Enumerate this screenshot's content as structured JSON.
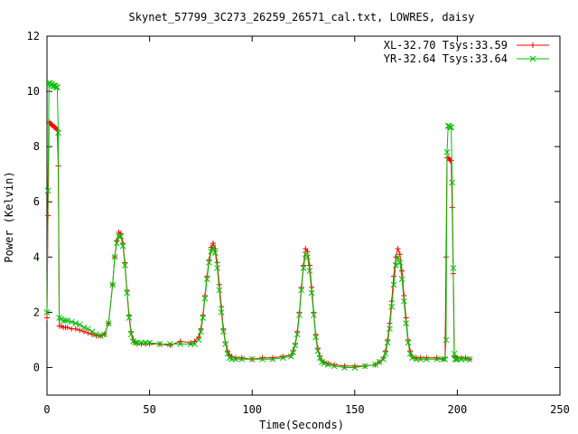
{
  "chart_data": {
    "type": "line",
    "title": "Skynet_57799_3C273_26259_26571_cal.txt, LOWRES, daisy",
    "xlabel": "Time(Seconds)",
    "ylabel": "Power (Kelvin)",
    "xlim": [
      0,
      250
    ],
    "ylim": [
      -1,
      12
    ],
    "xticks": [
      0,
      50,
      100,
      150,
      200,
      250
    ],
    "yticks": [
      0,
      2,
      4,
      6,
      8,
      10,
      12
    ],
    "grid": false,
    "legend_position": "top-right",
    "series": [
      {
        "name": "XL-32.70 Tsys:33.59",
        "color": "#ff0000",
        "marker": "+",
        "x": [
          0,
          0.5,
          1,
          1.5,
          2,
          2.5,
          3,
          3.5,
          4,
          4.5,
          5,
          5.5,
          6,
          7,
          8,
          9,
          10,
          12,
          14,
          16,
          18,
          20,
          22,
          24,
          26,
          28,
          30,
          32,
          33,
          34,
          35,
          36,
          37,
          38,
          39,
          40,
          41,
          42,
          43,
          44,
          46,
          48,
          50,
          55,
          60,
          65,
          70,
          72,
          74,
          75,
          76,
          77,
          78,
          79,
          80,
          81,
          82,
          83,
          84,
          85,
          86,
          87,
          88,
          89,
          90,
          92,
          95,
          100,
          105,
          110,
          115,
          119,
          120,
          121,
          122,
          123,
          124,
          125,
          126,
          127,
          128,
          129,
          130,
          131,
          132,
          133,
          134,
          135,
          137,
          140,
          145,
          150,
          155,
          160,
          162,
          164,
          165,
          166,
          167,
          168,
          169,
          170,
          171,
          172,
          173,
          174,
          175,
          176,
          177,
          178,
          180,
          182,
          185,
          190,
          193,
          194,
          194.5,
          195,
          195.5,
          196,
          196.5,
          197,
          197.5,
          198,
          198.5,
          199,
          199.5,
          200,
          202,
          204,
          206
        ],
        "y": [
          1.8,
          5.5,
          8.9,
          8.85,
          8.8,
          8.8,
          8.75,
          8.7,
          8.7,
          8.65,
          8.6,
          7.3,
          1.5,
          1.5,
          1.45,
          1.45,
          1.45,
          1.4,
          1.4,
          1.35,
          1.3,
          1.25,
          1.2,
          1.15,
          1.15,
          1.2,
          1.6,
          3.0,
          4.0,
          4.6,
          4.9,
          4.85,
          4.5,
          3.8,
          2.8,
          1.9,
          1.3,
          1.0,
          0.9,
          0.85,
          0.85,
          0.85,
          0.85,
          0.85,
          0.8,
          0.95,
          0.9,
          0.95,
          1.1,
          1.4,
          1.9,
          2.6,
          3.3,
          3.9,
          4.35,
          4.5,
          4.3,
          3.8,
          3.0,
          2.2,
          1.4,
          0.9,
          0.6,
          0.45,
          0.4,
          0.35,
          0.35,
          0.3,
          0.35,
          0.35,
          0.4,
          0.45,
          0.6,
          0.85,
          1.3,
          2.0,
          2.9,
          3.7,
          4.3,
          4.2,
          3.7,
          2.9,
          2.0,
          1.2,
          0.7,
          0.4,
          0.25,
          0.2,
          0.15,
          0.1,
          0.05,
          0.05,
          0.05,
          0.1,
          0.2,
          0.35,
          0.6,
          1.0,
          1.6,
          2.4,
          3.3,
          4.0,
          4.3,
          4.1,
          3.5,
          2.6,
          1.8,
          1.0,
          0.6,
          0.4,
          0.35,
          0.35,
          0.35,
          0.35,
          0.3,
          0.35,
          4.0,
          7.6,
          7.6,
          7.55,
          7.5,
          7.5,
          5.8,
          3.4,
          0.4,
          0.35,
          0.35,
          0.35,
          0.35,
          0.35,
          0.3
        ]
      },
      {
        "name": "YR-32.64 Tsys:33.64",
        "color": "#00c000",
        "marker": "x",
        "x": [
          0,
          0.5,
          1,
          1.5,
          2,
          2.5,
          3,
          3.5,
          4,
          4.5,
          5,
          5.5,
          6,
          7,
          8,
          9,
          10,
          12,
          14,
          16,
          18,
          20,
          22,
          24,
          26,
          28,
          30,
          32,
          33,
          34,
          35,
          36,
          37,
          38,
          39,
          40,
          41,
          42,
          43,
          44,
          46,
          48,
          50,
          55,
          60,
          65,
          70,
          72,
          74,
          75,
          76,
          77,
          78,
          79,
          80,
          81,
          82,
          83,
          84,
          85,
          86,
          87,
          88,
          89,
          90,
          92,
          95,
          100,
          105,
          110,
          115,
          119,
          120,
          121,
          122,
          123,
          124,
          125,
          126,
          127,
          128,
          129,
          130,
          131,
          132,
          133,
          134,
          135,
          137,
          140,
          145,
          150,
          155,
          160,
          162,
          164,
          165,
          166,
          167,
          168,
          169,
          170,
          171,
          172,
          173,
          174,
          175,
          176,
          177,
          178,
          180,
          182,
          185,
          190,
          193,
          194,
          194.5,
          195,
          195.5,
          196,
          196.5,
          197,
          197.5,
          198,
          198.5,
          199,
          199.5,
          200,
          202,
          204,
          206
        ],
        "y": [
          2.0,
          6.4,
          10.3,
          10.3,
          10.25,
          10.25,
          10.2,
          10.2,
          10.2,
          10.15,
          10.15,
          8.5,
          1.8,
          1.75,
          1.7,
          1.7,
          1.7,
          1.65,
          1.6,
          1.55,
          1.45,
          1.4,
          1.3,
          1.2,
          1.15,
          1.2,
          1.6,
          3.0,
          4.0,
          4.5,
          4.75,
          4.75,
          4.4,
          3.7,
          2.7,
          1.8,
          1.2,
          0.95,
          0.9,
          0.9,
          0.9,
          0.9,
          0.9,
          0.85,
          0.85,
          0.85,
          0.85,
          0.85,
          1.0,
          1.3,
          1.8,
          2.5,
          3.2,
          3.8,
          4.2,
          4.35,
          4.15,
          3.6,
          2.8,
          2.0,
          1.3,
          0.85,
          0.5,
          0.35,
          0.3,
          0.3,
          0.3,
          0.3,
          0.3,
          0.3,
          0.35,
          0.4,
          0.55,
          0.8,
          1.2,
          1.9,
          2.8,
          3.6,
          4.1,
          4.0,
          3.5,
          2.7,
          1.9,
          1.1,
          0.6,
          0.35,
          0.2,
          0.15,
          0.1,
          0.05,
          0.0,
          0.0,
          0.05,
          0.1,
          0.2,
          0.3,
          0.5,
          0.9,
          1.4,
          2.2,
          3.0,
          3.7,
          4.0,
          3.8,
          3.2,
          2.4,
          1.6,
          0.9,
          0.5,
          0.35,
          0.3,
          0.3,
          0.3,
          0.3,
          0.3,
          0.3,
          1.0,
          7.8,
          8.75,
          8.75,
          8.7,
          8.7,
          6.7,
          3.6,
          0.5,
          0.3,
          0.3,
          0.3,
          0.3,
          0.3,
          0.3
        ]
      }
    ]
  }
}
